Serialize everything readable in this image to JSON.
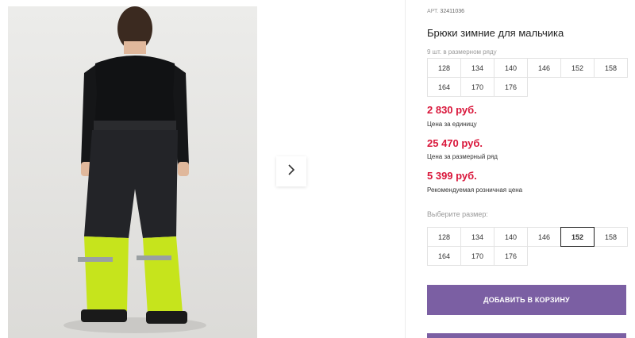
{
  "product": {
    "sku_label": "АРТ.",
    "sku": "32411036",
    "title": "Брюки зимние для мальчика",
    "row_note": "9 шт. в размерном ряду",
    "row_sizes": [
      "128",
      "134",
      "140",
      "146",
      "152",
      "158",
      "164",
      "170",
      "176"
    ],
    "prices": [
      {
        "value": "2 830 руб.",
        "caption": "Цена за единицу"
      },
      {
        "value": "25 470 руб.",
        "caption": "Цена за размерный ряд"
      },
      {
        "value": "5 399 руб.",
        "caption": "Рекомендуемая розничная цена"
      }
    ],
    "choose_size_label": "Выберите размер:",
    "size_options": [
      "128",
      "134",
      "140",
      "146",
      "152",
      "158",
      "164",
      "170",
      "176"
    ],
    "selected_size": "152",
    "add_to_cart_label": "ДОБАВИТЬ В КОРЗИНУ"
  },
  "colors": {
    "accent": "#7b5fa3",
    "price": "#d9163a",
    "pants_dark": "#1e1f22",
    "pants_lime": "#c6e41c"
  },
  "icons": {
    "gallery_next": "chevron-right-icon"
  }
}
